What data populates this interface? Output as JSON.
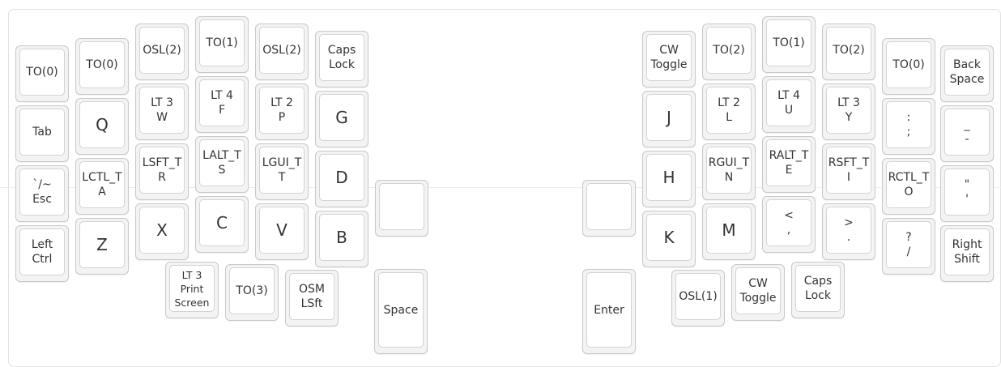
{
  "keyboard": {
    "left": {
      "col0": {
        "r0": [
          "TO(0)"
        ],
        "r1": [
          "Tab"
        ],
        "r2": [
          "`/~",
          "Esc"
        ],
        "r3": [
          "Left",
          "Ctrl"
        ]
      },
      "col1": {
        "r0": [
          "TO(0)"
        ],
        "r1": [
          "Q"
        ],
        "r2": [
          "LCTL_T",
          "A"
        ],
        "r3": [
          "Z"
        ]
      },
      "col2": {
        "r0": [
          "OSL(2)"
        ],
        "r1": [
          "LT 3",
          "W"
        ],
        "r2": [
          "LSFT_T",
          "R"
        ],
        "r3": [
          "X"
        ]
      },
      "col3": {
        "r0": [
          "TO(1)"
        ],
        "r1": [
          "LT 4",
          "F"
        ],
        "r2": [
          "LALT_T",
          "S"
        ],
        "r3": [
          "C"
        ]
      },
      "col4": {
        "r0": [
          "OSL(2)"
        ],
        "r1": [
          "LT 2",
          "P"
        ],
        "r2": [
          "LGUI_T",
          "T"
        ],
        "r3": [
          "V"
        ]
      },
      "col5": {
        "r0": [
          "Caps",
          "Lock"
        ],
        "r1": [
          "G"
        ],
        "r2": [
          "D"
        ],
        "r3": [
          "B"
        ]
      },
      "inner": [
        ""
      ],
      "thumb": {
        "t0": [
          "LT 3",
          "Print",
          "Screen"
        ],
        "t1": [
          "TO(3)"
        ],
        "t2": [
          "OSM",
          "LSft"
        ],
        "space": [
          "Space"
        ]
      }
    },
    "right": {
      "inner": [
        ""
      ],
      "col0": {
        "r0": [
          "CW",
          "Toggle"
        ],
        "r1": [
          "J"
        ],
        "r2": [
          "H"
        ],
        "r3": [
          "K"
        ]
      },
      "col1": {
        "r0": [
          "TO(2)"
        ],
        "r1": [
          "LT 2",
          "L"
        ],
        "r2": [
          "RGUI_T",
          "N"
        ],
        "r3": [
          "M"
        ]
      },
      "col2": {
        "r0": [
          "TO(1)"
        ],
        "r1": [
          "LT 4",
          "U"
        ],
        "r2": [
          "RALT_T",
          "E"
        ],
        "r3": [
          "<",
          ","
        ]
      },
      "col3": {
        "r0": [
          "TO(2)"
        ],
        "r1": [
          "LT 3",
          "Y"
        ],
        "r2": [
          "RSFT_T",
          "I"
        ],
        "r3": [
          ">",
          "."
        ]
      },
      "col4": {
        "r0": [
          "TO(0)"
        ],
        "r1": [
          ":",
          ";"
        ],
        "r2": [
          "RCTL_T",
          "O"
        ],
        "r3": [
          "?",
          "/"
        ]
      },
      "col5": {
        "r0": [
          "Back",
          "Space"
        ],
        "r1": [
          "_",
          "-"
        ],
        "r2": [
          "\"",
          "'"
        ],
        "r3": [
          "Right",
          "Shift"
        ]
      },
      "thumb": {
        "enter": [
          "Enter"
        ],
        "t0": [
          "OSL(1)"
        ],
        "t1": [
          "CW",
          "Toggle"
        ],
        "t2": [
          "Caps",
          "Lock"
        ]
      }
    }
  }
}
